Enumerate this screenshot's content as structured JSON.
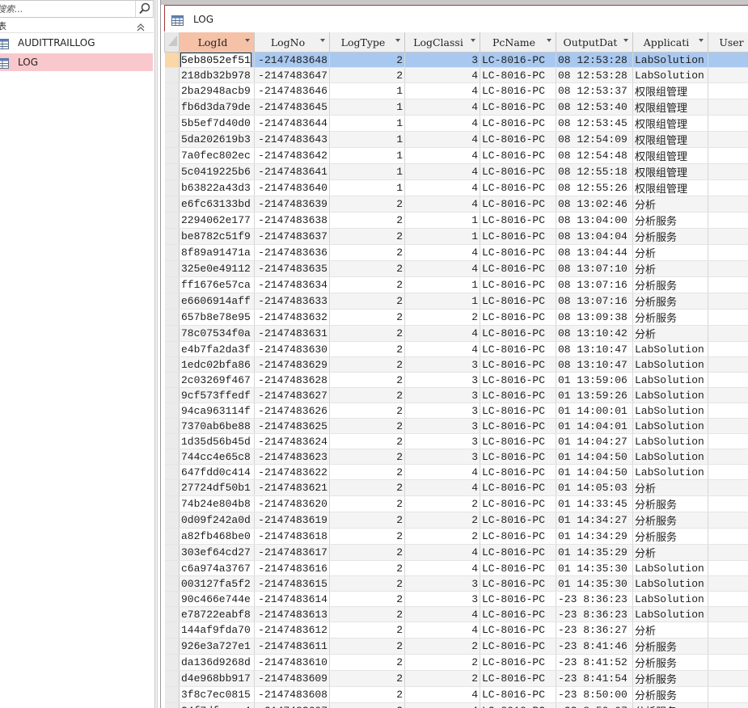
{
  "navigation": {
    "search_placeholder": "搜索...",
    "group_label": "表",
    "items": [
      {
        "label": "AUDITTRAILLOG",
        "selected": false
      },
      {
        "label": "LOG",
        "selected": true
      }
    ]
  },
  "document": {
    "tab_title": "LOG"
  },
  "table": {
    "columns": [
      "LogId",
      "LogNo",
      "LogType",
      "LogClassi",
      "PcName",
      "OutputDat",
      "Applicati",
      "User"
    ],
    "selected_column": "LogId",
    "current_row": 0,
    "rows": [
      [
        "5eb8052ef51",
        "-2147483648",
        "2",
        "3",
        "LC-8016-PC",
        "08 12:53:28",
        "LabSolution"
      ],
      [
        "218db32b978",
        "-2147483647",
        "2",
        "4",
        "LC-8016-PC",
        "08 12:53:28",
        "LabSolution"
      ],
      [
        "2ba2948acb9",
        "-2147483646",
        "1",
        "4",
        "LC-8016-PC",
        "08 12:53:37",
        "权限组管理"
      ],
      [
        "fb6d3da79de",
        "-2147483645",
        "1",
        "4",
        "LC-8016-PC",
        "08 12:53:40",
        "权限组管理"
      ],
      [
        "5b5ef7d40d0",
        "-2147483644",
        "1",
        "4",
        "LC-8016-PC",
        "08 12:53:45",
        "权限组管理"
      ],
      [
        "5da202619b3",
        "-2147483643",
        "1",
        "4",
        "LC-8016-PC",
        "08 12:54:09",
        "权限组管理"
      ],
      [
        "7a0fec802ec",
        "-2147483642",
        "1",
        "4",
        "LC-8016-PC",
        "08 12:54:48",
        "权限组管理"
      ],
      [
        "5c0419225b6",
        "-2147483641",
        "1",
        "4",
        "LC-8016-PC",
        "08 12:55:18",
        "权限组管理"
      ],
      [
        "b63822a43d3",
        "-2147483640",
        "1",
        "4",
        "LC-8016-PC",
        "08 12:55:26",
        "权限组管理"
      ],
      [
        "e6fc63133bd",
        "-2147483639",
        "2",
        "4",
        "LC-8016-PC",
        "08 13:02:46",
        "分析"
      ],
      [
        "2294062e177",
        "-2147483638",
        "2",
        "1",
        "LC-8016-PC",
        "08 13:04:00",
        "分析服务"
      ],
      [
        "be8782c51f9",
        "-2147483637",
        "2",
        "1",
        "LC-8016-PC",
        "08 13:04:04",
        "分析服务"
      ],
      [
        "8f89a91471a",
        "-2147483636",
        "2",
        "4",
        "LC-8016-PC",
        "08 13:04:44",
        "分析"
      ],
      [
        "325e0e49112",
        "-2147483635",
        "2",
        "4",
        "LC-8016-PC",
        "08 13:07:10",
        "分析"
      ],
      [
        "ff1676e57ca",
        "-2147483634",
        "2",
        "1",
        "LC-8016-PC",
        "08 13:07:16",
        "分析服务"
      ],
      [
        "e6606914aff",
        "-2147483633",
        "2",
        "1",
        "LC-8016-PC",
        "08 13:07:16",
        "分析服务"
      ],
      [
        "657b8e78e95",
        "-2147483632",
        "2",
        "2",
        "LC-8016-PC",
        "08 13:09:38",
        "分析服务"
      ],
      [
        "78c07534f0a",
        "-2147483631",
        "2",
        "4",
        "LC-8016-PC",
        "08 13:10:42",
        "分析"
      ],
      [
        "e4b7fa2da3f",
        "-2147483630",
        "2",
        "4",
        "LC-8016-PC",
        "08 13:10:47",
        "LabSolution"
      ],
      [
        "1edc02bfa86",
        "-2147483629",
        "2",
        "3",
        "LC-8016-PC",
        "08 13:10:47",
        "LabSolution"
      ],
      [
        "2c03269f467",
        "-2147483628",
        "2",
        "3",
        "LC-8016-PC",
        "01 13:59:06",
        "LabSolution"
      ],
      [
        "9cf573ffedf",
        "-2147483627",
        "2",
        "3",
        "LC-8016-PC",
        "01 13:59:26",
        "LabSolution"
      ],
      [
        "94ca963114f",
        "-2147483626",
        "2",
        "3",
        "LC-8016-PC",
        "01 14:00:01",
        "LabSolution"
      ],
      [
        "7370ab6be88",
        "-2147483625",
        "2",
        "3",
        "LC-8016-PC",
        "01 14:04:01",
        "LabSolution"
      ],
      [
        "1d35d56b45d",
        "-2147483624",
        "2",
        "3",
        "LC-8016-PC",
        "01 14:04:27",
        "LabSolution"
      ],
      [
        "744cc4e65c8",
        "-2147483623",
        "2",
        "3",
        "LC-8016-PC",
        "01 14:04:50",
        "LabSolution"
      ],
      [
        "647fdd0c414",
        "-2147483622",
        "2",
        "4",
        "LC-8016-PC",
        "01 14:04:50",
        "LabSolution"
      ],
      [
        "27724df50b1",
        "-2147483621",
        "2",
        "4",
        "LC-8016-PC",
        "01 14:05:03",
        "分析"
      ],
      [
        "74b24e804b8",
        "-2147483620",
        "2",
        "2",
        "LC-8016-PC",
        "01 14:33:45",
        "分析服务"
      ],
      [
        "0d09f242a0d",
        "-2147483619",
        "2",
        "2",
        "LC-8016-PC",
        "01 14:34:27",
        "分析服务"
      ],
      [
        "a82fb468be0",
        "-2147483618",
        "2",
        "2",
        "LC-8016-PC",
        "01 14:34:29",
        "分析服务"
      ],
      [
        "303ef64cd27",
        "-2147483617",
        "2",
        "4",
        "LC-8016-PC",
        "01 14:35:29",
        "分析"
      ],
      [
        "c6a974a3767",
        "-2147483616",
        "2",
        "4",
        "LC-8016-PC",
        "01 14:35:30",
        "LabSolution"
      ],
      [
        "003127fa5f2",
        "-2147483615",
        "2",
        "3",
        "LC-8016-PC",
        "01 14:35:30",
        "LabSolution"
      ],
      [
        "90c466e744e",
        "-2147483614",
        "2",
        "3",
        "LC-8016-PC",
        "-23 8:36:23",
        "LabSolution"
      ],
      [
        "e78722eabf8",
        "-2147483613",
        "2",
        "4",
        "LC-8016-PC",
        "-23 8:36:23",
        "LabSolution"
      ],
      [
        "144af9fda70",
        "-2147483612",
        "2",
        "4",
        "LC-8016-PC",
        "-23 8:36:27",
        "分析"
      ],
      [
        "926e3a727e1",
        "-2147483611",
        "2",
        "2",
        "LC-8016-PC",
        "-23 8:41:46",
        "分析服务"
      ],
      [
        "da136d9268d",
        "-2147483610",
        "2",
        "2",
        "LC-8016-PC",
        "-23 8:41:52",
        "分析服务"
      ],
      [
        "d4e968bb917",
        "-2147483609",
        "2",
        "2",
        "LC-8016-PC",
        "-23 8:41:54",
        "分析服务"
      ],
      [
        "3f8c7ec0815",
        "-2147483608",
        "2",
        "4",
        "LC-8016-PC",
        "-23 8:50:00",
        "分析服务"
      ],
      [
        "24f7dfacae4",
        "-2147483607",
        "2",
        "4",
        "LC-8016-PC",
        "-23 8:50:07",
        "分析服务"
      ],
      [
        "896c113db59",
        "-2147483606",
        "2",
        "4",
        "LC-8016-PC",
        "-23 8:50:27",
        "分析服务"
      ]
    ]
  },
  "colors": {
    "selected_nav_item": "#f8c8cc",
    "current_row": "#a8c8f0",
    "selected_column_header": "#f5c2a8",
    "tab_accent": "#a4373a"
  }
}
